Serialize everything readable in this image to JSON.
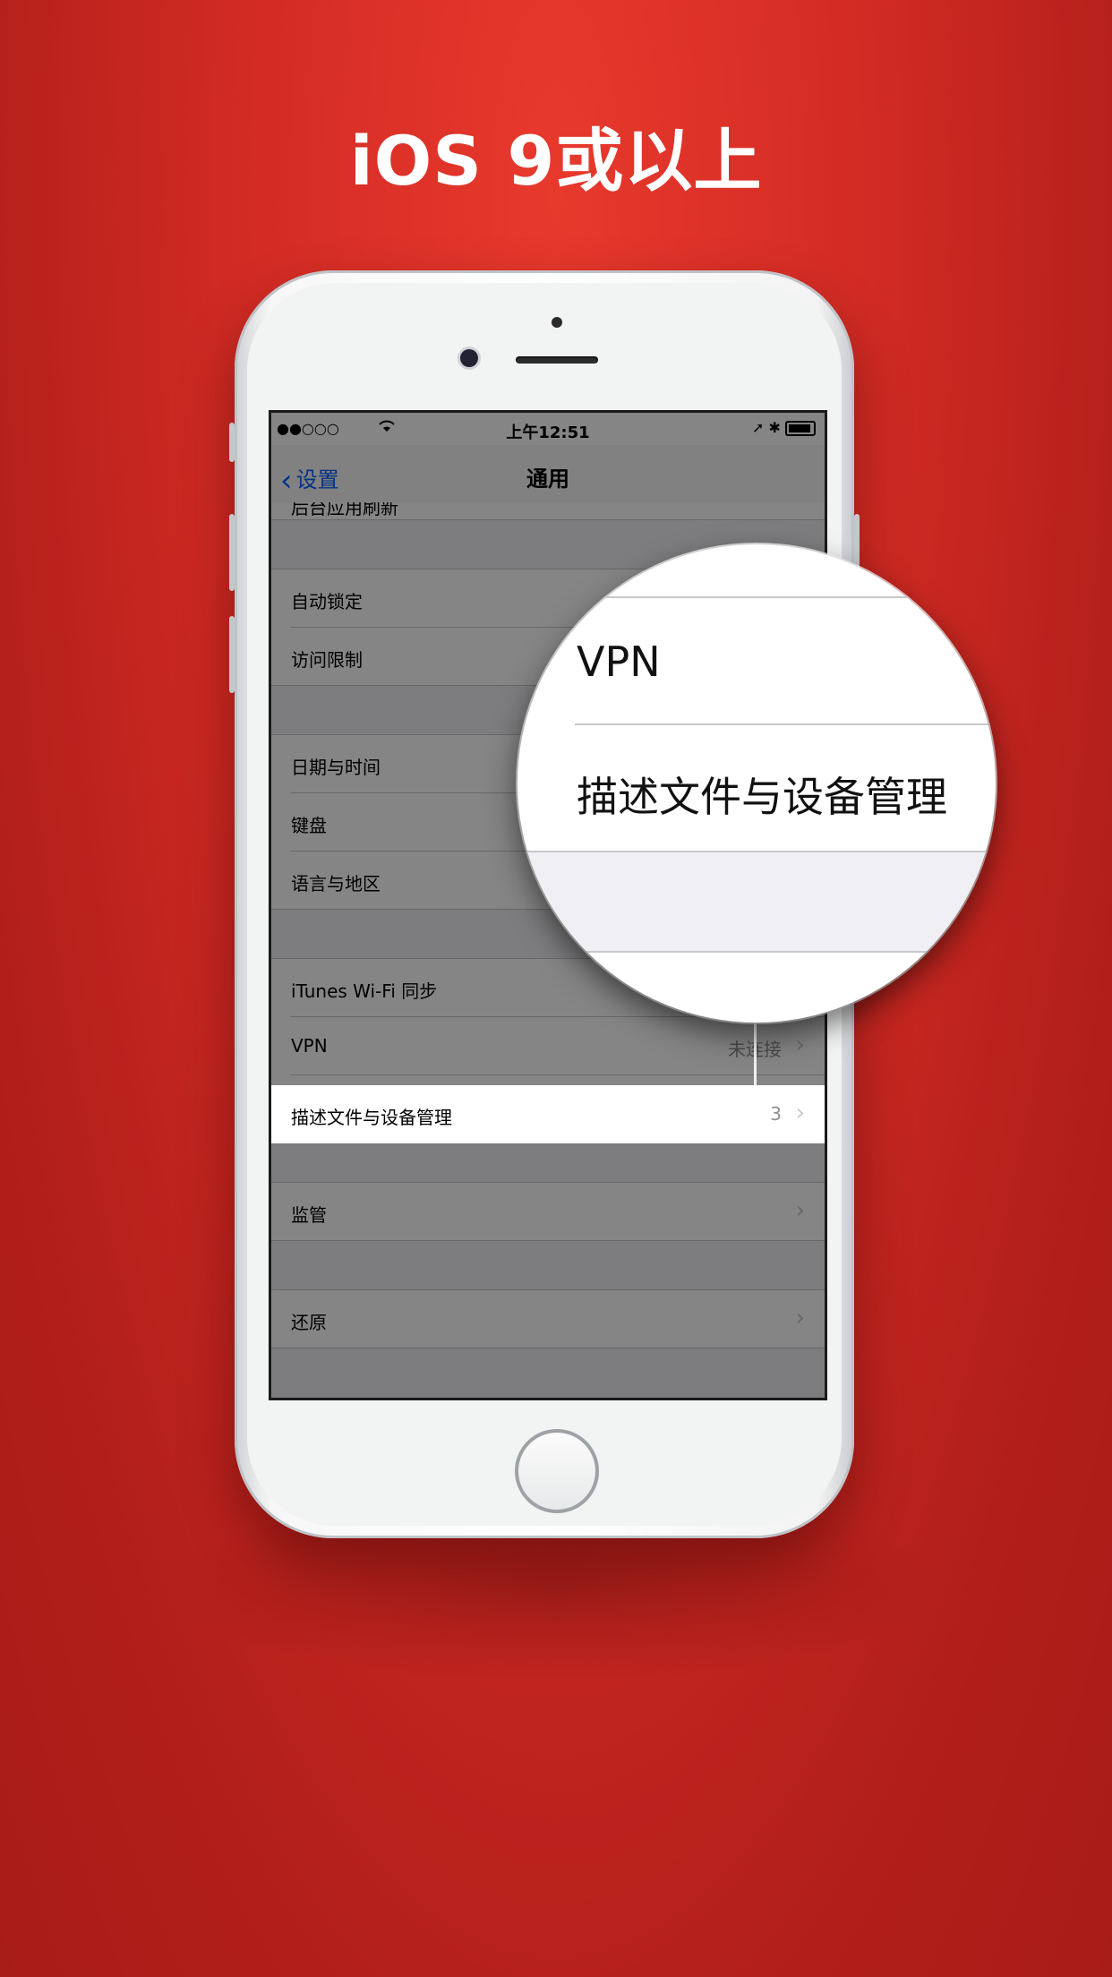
{
  "headline": "iOS 9或以上",
  "status_bar": {
    "signal": "●●○○○",
    "time": "上午12:51",
    "right_icons": "➚ ✱"
  },
  "nav": {
    "back_label": "设置",
    "title": "通用"
  },
  "settings": {
    "row_partial": "后台应用刷新",
    "group1": [
      "自动锁定",
      "访问限制"
    ],
    "group2": [
      "日期与时间",
      "键盘",
      "语言与地区"
    ],
    "itunes": "iTunes Wi-Fi 同步",
    "vpn": {
      "label": "VPN",
      "value": "未连接"
    },
    "profiles": {
      "label": "描述文件与设备管理",
      "value": "3"
    },
    "supervision": "监管",
    "reset": "还原"
  },
  "magnifier": {
    "line1": "VPN",
    "line2": "描述文件与设备管理"
  },
  "colors": {
    "background": "#d22b24",
    "ios_blue": "#0a60ff",
    "group_gap": "#efeff4"
  }
}
